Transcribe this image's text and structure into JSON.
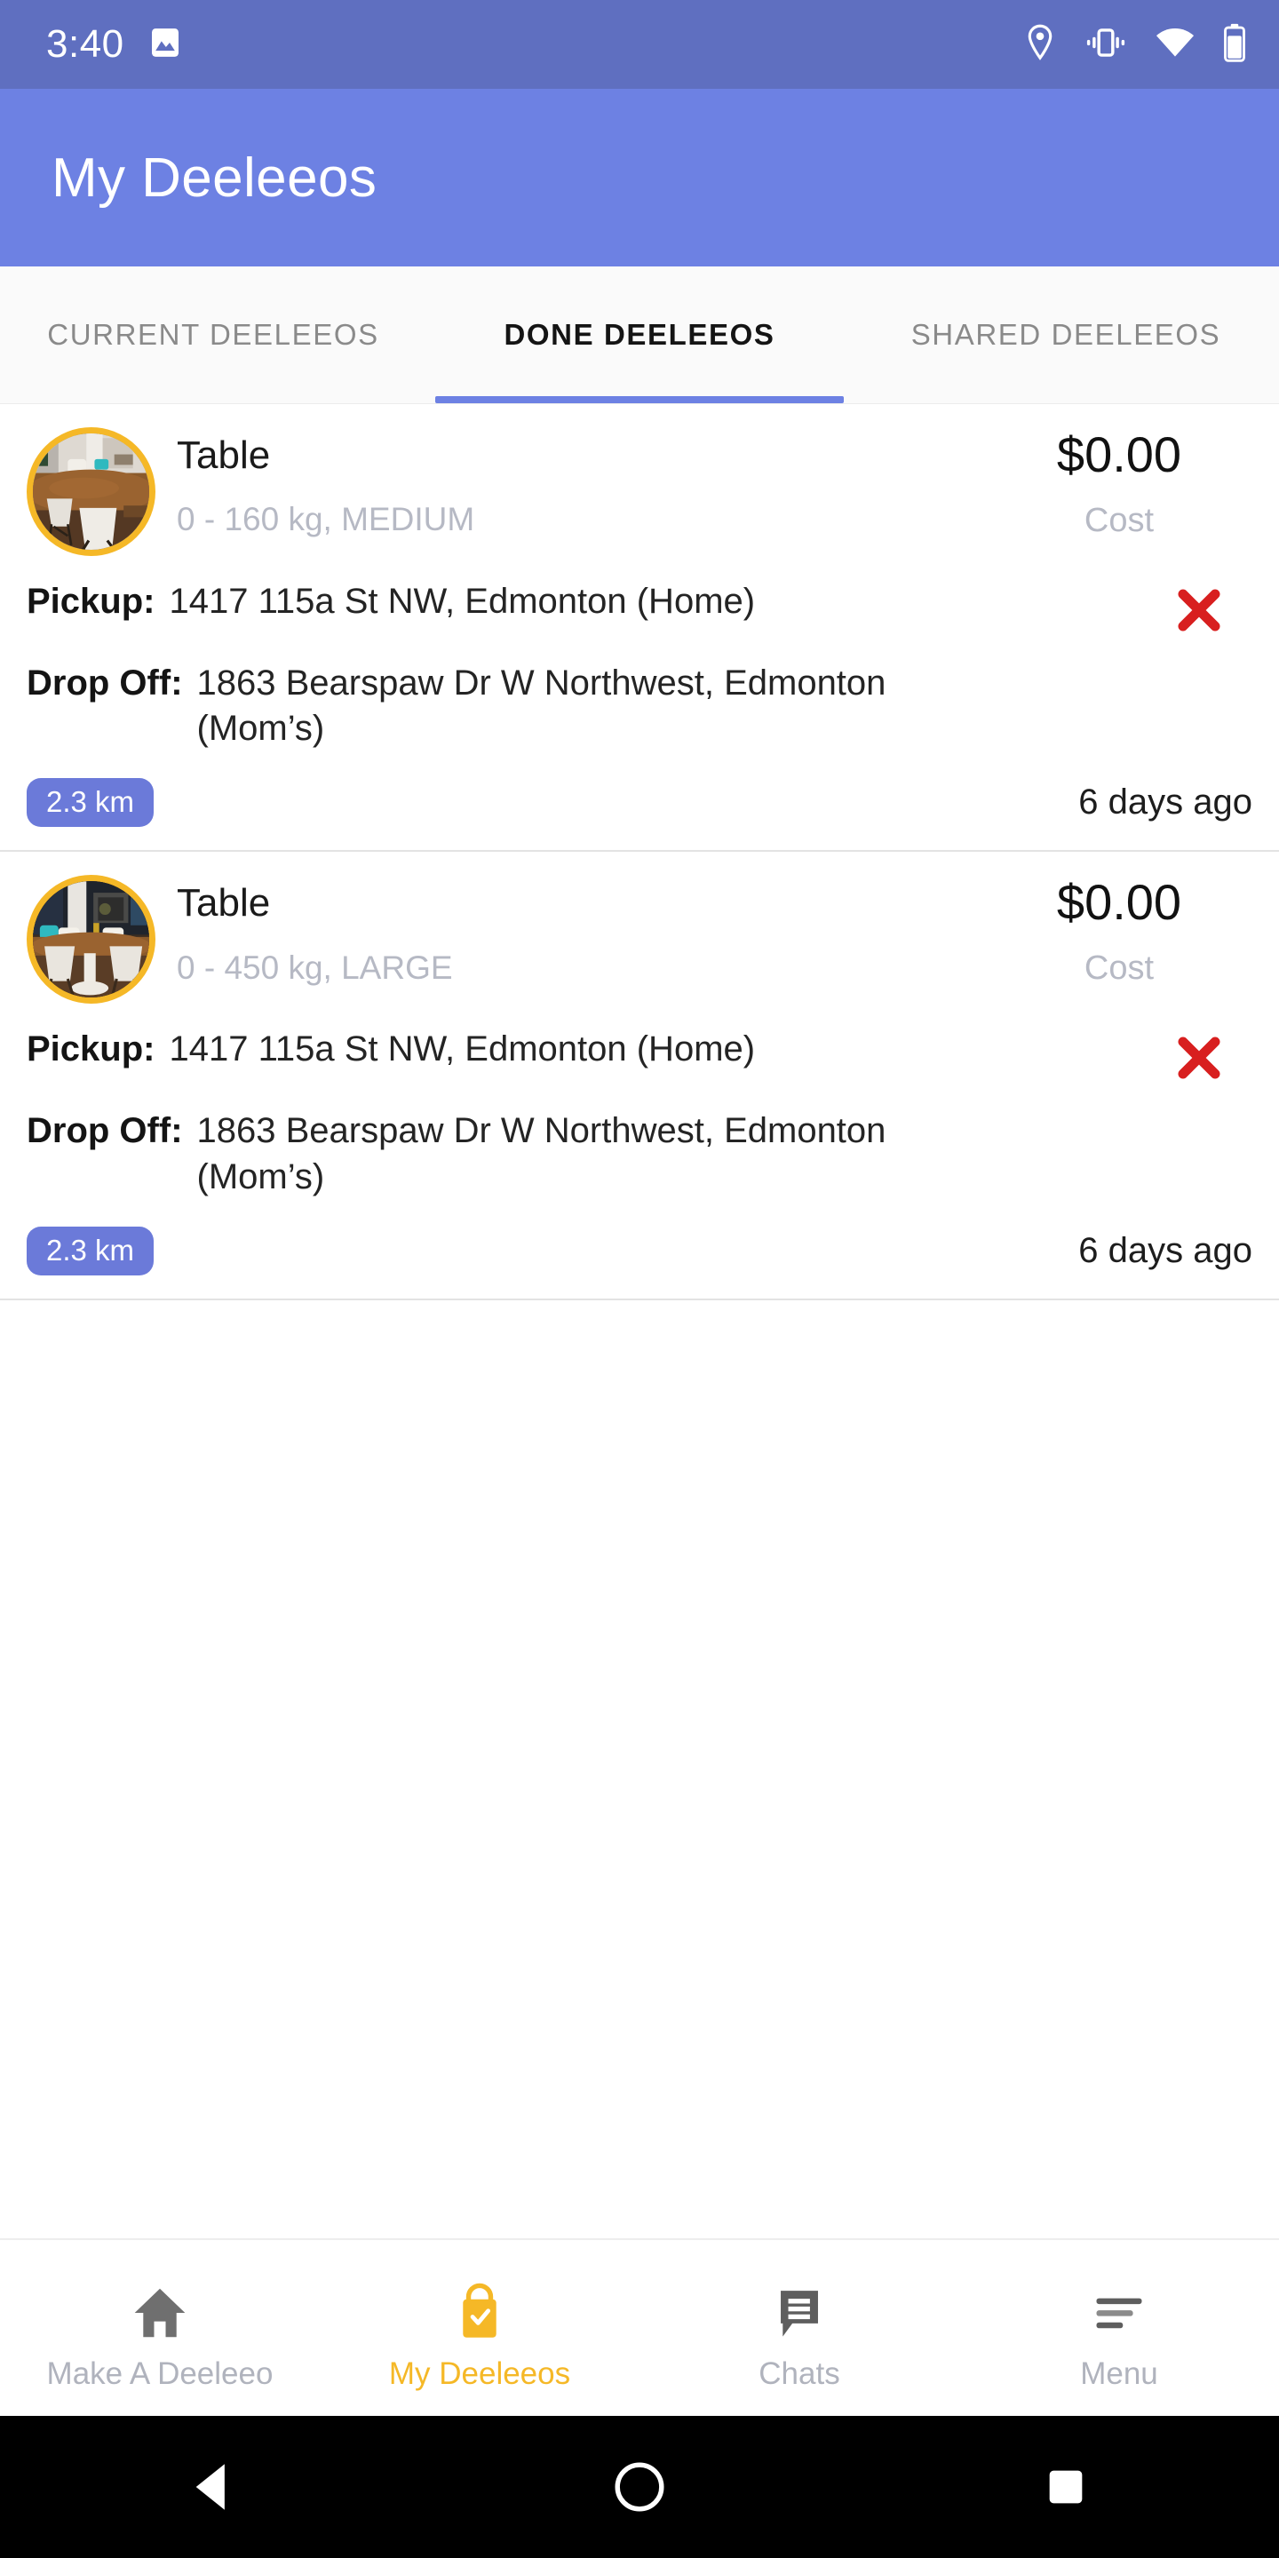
{
  "status_bar": {
    "time": "3:40",
    "icons": [
      "image-icon",
      "location-pin-icon",
      "vibrate-icon",
      "wifi-icon",
      "battery-icon"
    ]
  },
  "app_bar": {
    "title": "My Deeleeos"
  },
  "tabs": [
    {
      "label": "CURRENT DEELEEOS",
      "active": false
    },
    {
      "label": "DONE DEELEEOS",
      "active": true
    },
    {
      "label": "SHARED DEELEEOS",
      "active": false
    }
  ],
  "list": {
    "pickup_key": "Pickup:",
    "dropoff_key": "Drop Off:",
    "cost_label": "Cost",
    "items": [
      {
        "name": "Table",
        "spec": "0 - 160 kg, MEDIUM",
        "price": "$0.00",
        "cost_label": "Cost",
        "pickup_key": "Pickup:",
        "pickup": "1417 115a St NW, Edmonton (Home)",
        "dropoff_key": "Drop Off:",
        "dropoff": "1863 Bearspaw Dr W Northwest, Edmonton (Mom’s)",
        "distance": "2.3 km",
        "time_ago": "6 days ago",
        "cancel_icon": "red-x-icon",
        "thumbnail": "dining-table-photo"
      },
      {
        "name": "Table",
        "spec": "0 - 450 kg, LARGE",
        "price": "$0.00",
        "cost_label": "Cost",
        "pickup_key": "Pickup:",
        "pickup": "1417 115a St NW, Edmonton (Home)",
        "dropoff_key": "Drop Off:",
        "dropoff": "1863 Bearspaw Dr W Northwest, Edmonton (Mom’s)",
        "distance": "2.3 km",
        "time_ago": "6 days ago",
        "cancel_icon": "red-x-icon",
        "thumbnail": "dining-table-night-photo"
      }
    ]
  },
  "bottom_nav": [
    {
      "label": "Make A Deeleeo",
      "icon": "home-icon",
      "active": false
    },
    {
      "label": "My Deeleeos",
      "icon": "shopping-bag-check-icon",
      "active": true
    },
    {
      "label": "Chats",
      "icon": "chat-bubble-icon",
      "active": false
    },
    {
      "label": "Menu",
      "icon": "hamburger-menu-icon",
      "active": false
    }
  ],
  "android_nav": [
    {
      "name": "back-button",
      "icon": "triangle-back-icon"
    },
    {
      "name": "home-button",
      "icon": "circle-home-icon"
    },
    {
      "name": "recents-button",
      "icon": "square-recents-icon"
    }
  ],
  "colors": {
    "status_bar": "#5f6fc0",
    "app_bar": "#6d81e3",
    "accent_yellow": "#f5b827",
    "badge_blue": "#6b7ad9",
    "cancel_red": "#d81f1f",
    "muted_text": "#b6b9c4"
  }
}
